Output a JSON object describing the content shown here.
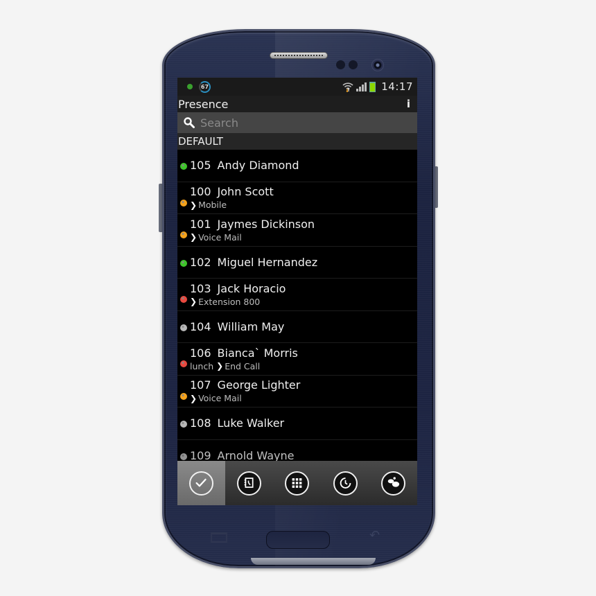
{
  "device": {
    "model": "smartphone",
    "color_body": "#1d2442"
  },
  "statusbar": {
    "notification_badge": "67",
    "time": "14:17",
    "icons": [
      "notification-dot-icon",
      "progress-badge-icon",
      "wifi-icon",
      "signal-icon",
      "battery-icon"
    ],
    "battery_color": "#8bd700"
  },
  "titlebar": {
    "title": "Presence",
    "info_label": "i"
  },
  "search": {
    "placeholder": "Search",
    "value": ""
  },
  "group": {
    "name": "DEFAULT"
  },
  "presence_colors": {
    "available": "#3ec52a",
    "away": "#f5a21b",
    "busy": "#e8493f",
    "offline": "#b8b8b8"
  },
  "contacts": [
    {
      "ext": "105",
      "name": "Andy Diamond",
      "status": "available",
      "note": "",
      "forward": ""
    },
    {
      "ext": "100",
      "name": "John Scott",
      "status": "away",
      "note": "",
      "forward": "Mobile"
    },
    {
      "ext": "101",
      "name": "Jaymes Dickinson",
      "status": "away",
      "note": "",
      "forward": "Voice Mail"
    },
    {
      "ext": "102",
      "name": "Miguel Hernandez",
      "status": "available",
      "note": "",
      "forward": ""
    },
    {
      "ext": "103",
      "name": "Jack Horacio",
      "status": "busy",
      "note": "",
      "forward": "Extension 800"
    },
    {
      "ext": "104",
      "name": "William May",
      "status": "offline",
      "note": "",
      "forward": ""
    },
    {
      "ext": "106",
      "name": "Bianca` Morris",
      "status": "busy",
      "note": "lunch",
      "forward": "End Call"
    },
    {
      "ext": "107",
      "name": "George Lighter",
      "status": "away",
      "note": "",
      "forward": "Voice Mail"
    },
    {
      "ext": "108",
      "name": "Luke Walker",
      "status": "offline",
      "note": "",
      "forward": ""
    },
    {
      "ext": "109",
      "name": "Arnold Wayne",
      "status": "offline",
      "note": "",
      "forward": ""
    }
  ],
  "navbar": {
    "active_index": 0,
    "items": [
      {
        "icon": "checkmark-icon",
        "label": "Presence"
      },
      {
        "icon": "phonebook-icon",
        "label": "Contacts"
      },
      {
        "icon": "dialpad-icon",
        "label": "Dialpad"
      },
      {
        "icon": "history-icon",
        "label": "History"
      },
      {
        "icon": "chat-icon",
        "label": "Chat"
      }
    ]
  }
}
